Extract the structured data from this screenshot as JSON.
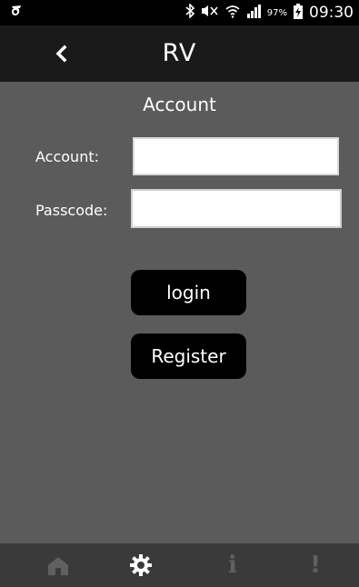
{
  "status_bar": {
    "left_icon": "notification-icon",
    "icons": [
      "bluetooth-icon",
      "mute-icon",
      "wifi-icon",
      "signal-icon",
      "battery-icon"
    ],
    "battery_percent": "97%",
    "time": "09:30"
  },
  "header": {
    "back_icon": "chevron-left-icon",
    "title": "RV"
  },
  "main": {
    "section_title": "Account",
    "account_label": "Account:",
    "account_value": "",
    "passcode_label": "Passcode:",
    "passcode_value": "",
    "login_label": "login",
    "register_label": "Register"
  },
  "bottom_nav": {
    "items": [
      {
        "icon": "home-icon",
        "active": false
      },
      {
        "icon": "gear-icon",
        "active": true
      },
      {
        "icon": "info-icon",
        "label": "i",
        "active": false
      },
      {
        "icon": "alert-icon",
        "label": "!",
        "active": false
      }
    ]
  },
  "colors": {
    "background": "#5b5b5b",
    "header": "#1a1a1a",
    "status_bar": "#000000",
    "button": "#000000",
    "nav_bar": "#3a3a3a",
    "nav_icon_inactive": "#606060",
    "nav_icon_active": "#ffffff"
  }
}
